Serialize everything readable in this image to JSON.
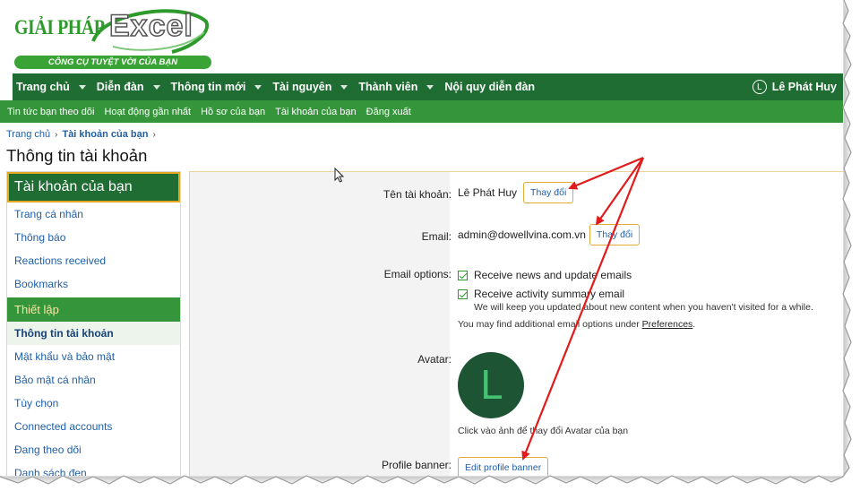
{
  "logo": {
    "brand_left": "GIẢI PHÁP",
    "brand_right": "Excel",
    "tagline": "CÔNG CỤ TUYỆT VỜI CỦA BẠN"
  },
  "nav": {
    "items": [
      {
        "label": "Trang chủ"
      },
      {
        "label": "Diễn đàn"
      },
      {
        "label": "Thông tin mới"
      },
      {
        "label": "Tài nguyên"
      },
      {
        "label": "Thành viên"
      },
      {
        "label": "Nội quy diễn đàn"
      }
    ],
    "user_initial": "L",
    "user_name": "Lê Phát Huy"
  },
  "subnav": {
    "items": [
      "Tin tức bạn theo dõi",
      "Hoạt động gần nhất",
      "Hồ sơ của bạn",
      "Tài khoản của bạn",
      "Đăng xuất"
    ]
  },
  "breadcrumb": {
    "home": "Trang chủ",
    "current": "Tài khoản của bạn"
  },
  "page_title": "Thông tin tài khoản",
  "sidebar": {
    "heading": "Tài khoản của bạn",
    "items_top": [
      "Trang cá nhân",
      "Thông báo",
      "Reactions received",
      "Bookmarks"
    ],
    "group_label": "Thiết lập",
    "items_settings": [
      "Thông tin tài khoản",
      "Mật khẩu và bảo mật",
      "Bảo mật cá nhân",
      "Tùy chọn",
      "Connected accounts",
      "Đang theo dõi",
      "Danh sách đen"
    ]
  },
  "form": {
    "username_label": "Tên tài khoản:",
    "username_value": "Lê Phát Huy",
    "username_change": "Thay đổi",
    "email_label": "Email:",
    "email_value": "admin@dowellvina.com.vn",
    "email_change": "Thay đổi",
    "email_options_label": "Email options:",
    "opt_news": "Receive news and update emails",
    "opt_activity": "Receive activity summary email",
    "opt_activity_hint": "We will keep you updated about new content when you haven't visited for a while.",
    "prefs_hint_before": "You may find additional email options under ",
    "prefs_link": "Preferences",
    "prefs_hint_after": ".",
    "avatar_label": "Avatar:",
    "avatar_initial": "L",
    "avatar_hint": "Click vào ảnh để thay đổi Avatar của bạn",
    "banner_label": "Profile banner:",
    "banner_button": "Edit profile banner"
  },
  "colors": {
    "nav_green": "#1f6d33",
    "subnav_green": "#35953a",
    "accent_orange": "#e3a93a",
    "link_blue": "#1f5fa8",
    "arrow_red": "#e11b1b"
  }
}
